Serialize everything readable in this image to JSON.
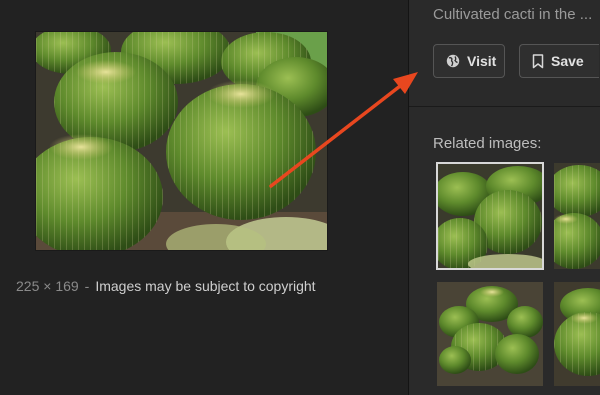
{
  "main_image": {
    "dimensions": "225 × 169",
    "separator": "-",
    "copyright_note": "Images may be subject to copyright"
  },
  "detail": {
    "title": "Cultivated cacti in the ..."
  },
  "actions": {
    "visit_label": "Visit",
    "save_label": "Save"
  },
  "related": {
    "label": "Related images:"
  },
  "icons": {
    "visit": "globe-icon",
    "save": "bookmark-icon"
  },
  "colors": {
    "background": "#222222",
    "right_panel": "#2a2a2a",
    "annotation_arrow": "#e8471f"
  }
}
